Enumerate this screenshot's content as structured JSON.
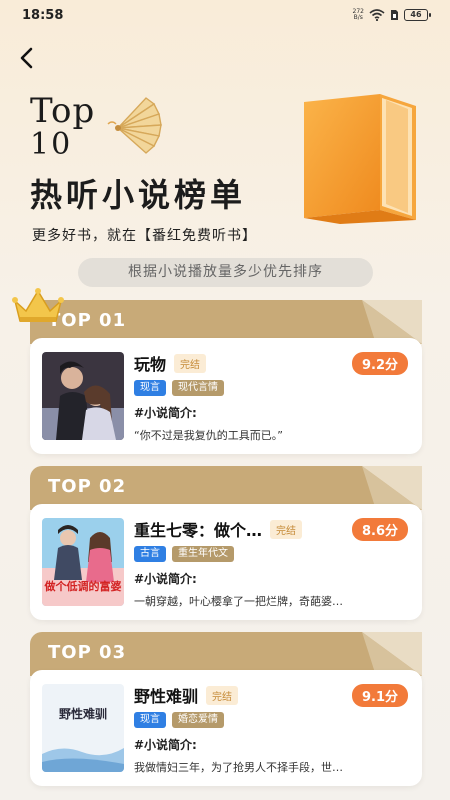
{
  "status_bar": {
    "time": "18:58",
    "net_speed_value": "272",
    "net_speed_unit": "B/s",
    "battery": "46"
  },
  "hero": {
    "top_line1": "Top",
    "top_line2": "10",
    "title": "热听小说榜单",
    "subtitle": "更多好书，就在【番红免费听书】",
    "rule": "根据小说播放量多少优先排序"
  },
  "ranks": [
    {
      "label": "TOP 01",
      "name": "玩物",
      "status": "完结",
      "score": "9.2分",
      "tags": [
        "现言",
        "现代言情"
      ],
      "intro_heading": "#小说简介:",
      "intro": "“你不过是我复仇的工具而已。”"
    },
    {
      "label": "TOP 02",
      "name": "重生七零：做个…",
      "status": "完结",
      "score": "8.6分",
      "tags": [
        "古言",
        "重生年代文"
      ],
      "intro_heading": "#小说简介:",
      "intro": "一朝穿越，叶心樱拿了一把烂牌，奇葩婆…",
      "cover_text": "做个低调的富婆"
    },
    {
      "label": "TOP 03",
      "name": "野性难驯",
      "status": "完结",
      "score": "9.1分",
      "tags": [
        "现言",
        "婚恋爱情"
      ],
      "intro_heading": "#小说简介:",
      "intro": "我做情妇三年，为了抢男人不择手段，世…",
      "cover_text": "野性难驯"
    }
  ],
  "colors": {
    "accent": "#f27a3a",
    "section": "#c8aa78",
    "tag_blue": "#2f7fe3",
    "tag_gold": "#b59a6a",
    "book": "#f39a2b"
  }
}
